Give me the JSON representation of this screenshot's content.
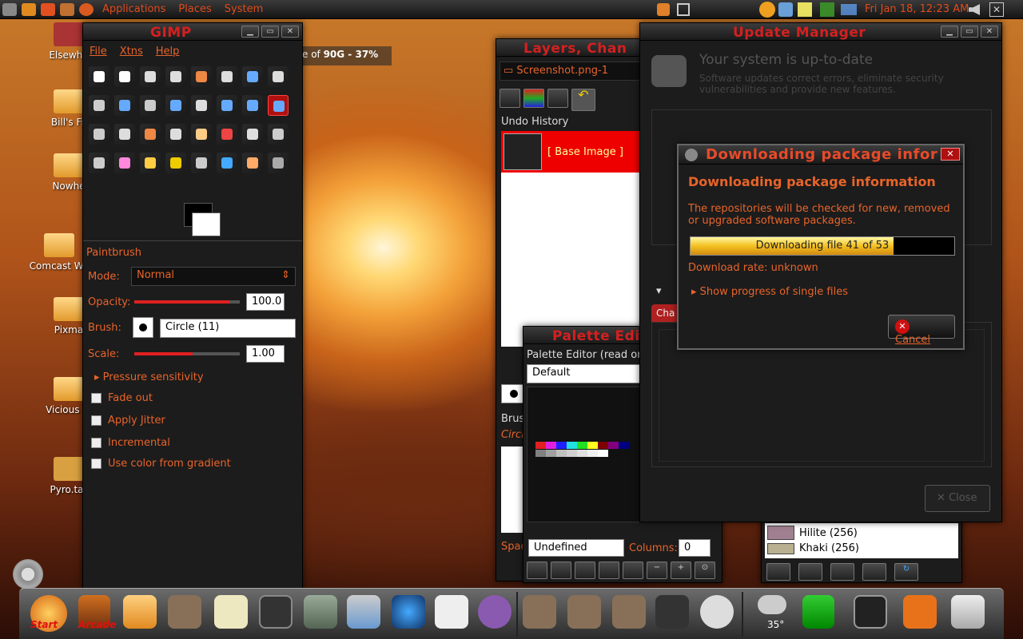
{
  "top_panel": {
    "menus": [
      "Applications",
      "Places",
      "System"
    ],
    "clock": "Fri Jan 18, 12:23 AM"
  },
  "desktop": {
    "icons": [
      "Elsewhe",
      "Bill's Fil",
      "Nowhe",
      "Comcast We",
      "Pixma",
      "Vicious Bi",
      "Pyro.tar"
    ]
  },
  "disk_text": {
    "prefix": "e of ",
    "bold": "90G - 37%"
  },
  "gimp": {
    "title": "GIMP",
    "menu": [
      "File",
      "Xtns",
      "Help"
    ],
    "options": {
      "header": "Paintbrush",
      "mode_label": "Mode:",
      "mode_value": "Normal",
      "opacity_label": "Opacity:",
      "opacity_value": "100.0",
      "brush_label": "Brush:",
      "brush_value": "Circle (11)",
      "scale_label": "Scale:",
      "scale_value": "1.00",
      "pressure": "Pressure sensitivity",
      "checks": [
        "Fade out",
        "Apply Jitter",
        "Incremental",
        "Use color from gradient"
      ]
    },
    "opacity_level": 0.9,
    "scale_level": 0.55
  },
  "layers": {
    "title": "Layers, Chan",
    "image": "Screenshot.png-1",
    "undo_label": "Undo History",
    "base_image": "[ Base Image ]",
    "brush_label": "Brus",
    "brush_value": "Circle",
    "spacing": "Spac"
  },
  "palette": {
    "title": "Palette Edit",
    "subtitle": "Palette Editor (read on",
    "name": "Default",
    "undefined": "Undefined",
    "columns_label": "Columns:",
    "columns_value": "0",
    "swatches_row1": [
      "#e02020",
      "#e020e0",
      "#2020ff",
      "#20e0e0",
      "#20e020",
      "#ffff20",
      "#800000",
      "#800080",
      "#000080"
    ],
    "swatches_row2": [
      "#808080",
      "#a0a0a0",
      "#c0c0c0",
      "#d0d0d0",
      "#e0e0e0",
      "#f0f0f0",
      "#ffffff"
    ]
  },
  "update_manager": {
    "title": "Update Manager",
    "heading": "Your system is up-to-date",
    "desc": "Software updates correct errors, eliminate security vulnerabilities and provide new features.",
    "tab": "Cha",
    "close": "Close"
  },
  "download": {
    "title": "Downloading package inform",
    "heading": "Downloading package information",
    "desc": "The repositories will be checked for new, removed or upgraded software packages.",
    "progress_text": "Downloading file 41 of 53",
    "progress": 0.77,
    "rate": "Download rate: unknown",
    "single": "Show progress of single files",
    "cancel": "Cancel"
  },
  "colors_list": {
    "items": [
      "Hilite (256)",
      "Khaki (256)"
    ]
  },
  "dock": {
    "start": "Start",
    "arcade": "Arcade",
    "weather": "35°"
  }
}
